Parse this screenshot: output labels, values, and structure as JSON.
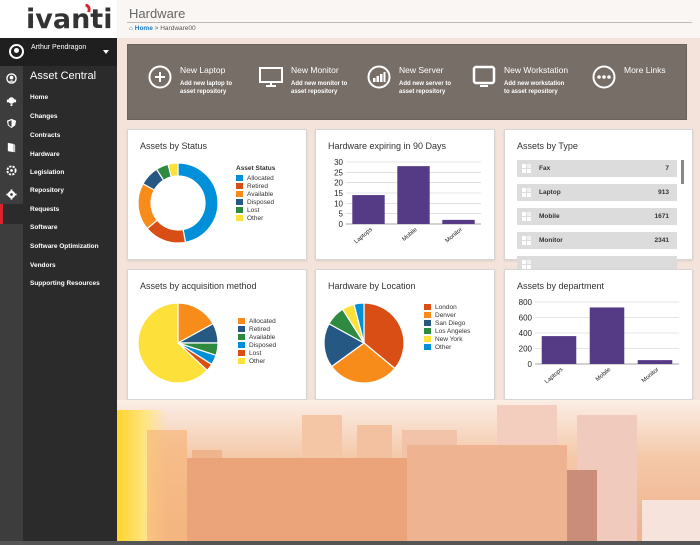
{
  "brand": {
    "logo_text": "ivanti",
    "accent": "#d9232e"
  },
  "user": {
    "name": "Arthur Pendragon"
  },
  "sidebar": {
    "section_title": "Asset Central",
    "active_item": "Hardware",
    "rail_icons": [
      "user-circle-icon",
      "headset-icon",
      "shield-icon",
      "book-icon",
      "gear-dashed-icon",
      "cog-icon"
    ],
    "items": [
      {
        "label": "Home"
      },
      {
        "label": "Changes"
      },
      {
        "label": "Contracts"
      },
      {
        "label": "Hardware"
      },
      {
        "label": "Legislation"
      },
      {
        "label": "Repository"
      },
      {
        "label": "Requests"
      },
      {
        "label": "Software"
      },
      {
        "label": "Software Optimization"
      },
      {
        "label": "Vendors"
      },
      {
        "label": "Supporting Resources"
      }
    ]
  },
  "header": {
    "title": "Hardware",
    "breadcrumb": {
      "home": "Home",
      "separator": ">",
      "current": "Hardware00"
    }
  },
  "quick_links": [
    {
      "icon": "plus-circle-icon",
      "title": "New Laptop",
      "line1": "Add new laptop to",
      "line2": "asset repository"
    },
    {
      "icon": "monitor-icon",
      "title": "New Monitor",
      "line1": "Add new monitor to",
      "line2": "asset repository"
    },
    {
      "icon": "signal-bars-icon",
      "title": "New Server",
      "line1": "Add new server to",
      "line2": "asset repository"
    },
    {
      "icon": "workstation-icon",
      "title": "New Workstation",
      "line1": "Add new workstation",
      "line2": "to asset repository"
    },
    {
      "icon": "ellipsis-circle-icon",
      "title": "More Links",
      "line1": "",
      "line2": ""
    }
  ],
  "assets_by_type": {
    "title": "Assets by Type",
    "rows": [
      {
        "label": "Fax",
        "count": "7"
      },
      {
        "label": "Laptop",
        "count": "913"
      },
      {
        "label": "Mobile",
        "count": "1671"
      },
      {
        "label": "Monitor",
        "count": "2341"
      },
      {
        "label": "",
        "count": ""
      }
    ]
  },
  "chart_data": [
    {
      "id": "status",
      "type": "pie",
      "donut": true,
      "title": "Assets by Status",
      "legend_title": "Asset Status",
      "legend_position": "right",
      "labels": [
        "Allocated",
        "Retired",
        "Available",
        "Disposed",
        "Lost",
        "Other"
      ],
      "values": [
        47,
        17,
        19,
        8,
        5,
        4
      ],
      "colors": [
        "#0090d9",
        "#d94e14",
        "#f78c1b",
        "#255883",
        "#2e8a3e",
        "#fde03a"
      ]
    },
    {
      "id": "expiring",
      "type": "bar",
      "title": "Hardware expiring in 90 Days",
      "categories": [
        "Laptops",
        "Mobile",
        "Monitor"
      ],
      "values": [
        14,
        28,
        2
      ],
      "yticks": [
        0,
        5,
        10,
        15,
        20,
        25,
        30
      ],
      "ylim": [
        0,
        30
      ],
      "grid": true,
      "color": "#553a86"
    },
    {
      "id": "acquisition",
      "type": "pie",
      "title": "Assets by acquisition method",
      "legend_title": "",
      "legend_position": "right",
      "labels": [
        "Allocated",
        "Retired",
        "Available",
        "Disposed",
        "Lost",
        "Other"
      ],
      "values": [
        17,
        8,
        5,
        4,
        3,
        63
      ],
      "colors": [
        "#f78c1b",
        "#255883",
        "#2e8a3e",
        "#0090d9",
        "#d94e14",
        "#fde03a"
      ]
    },
    {
      "id": "location",
      "type": "pie",
      "title": "Hardware by Location",
      "legend_title": "",
      "legend_position": "right",
      "labels": [
        "London",
        "Denver",
        "San Diego",
        "Los Angeles",
        "New York",
        "Other"
      ],
      "values": [
        36,
        29,
        18,
        8,
        5,
        4
      ],
      "colors": [
        "#d94e14",
        "#f78c1b",
        "#255883",
        "#2e8a3e",
        "#fde03a",
        "#0090d9"
      ]
    },
    {
      "id": "department",
      "type": "bar",
      "title": "Assets by department",
      "categories": [
        "Laptops",
        "Mobile",
        "Monitor"
      ],
      "values": [
        360,
        730,
        50
      ],
      "yticks": [
        0,
        200,
        400,
        600,
        800
      ],
      "ylim": [
        0,
        800
      ],
      "grid": true,
      "color": "#553a86"
    }
  ]
}
